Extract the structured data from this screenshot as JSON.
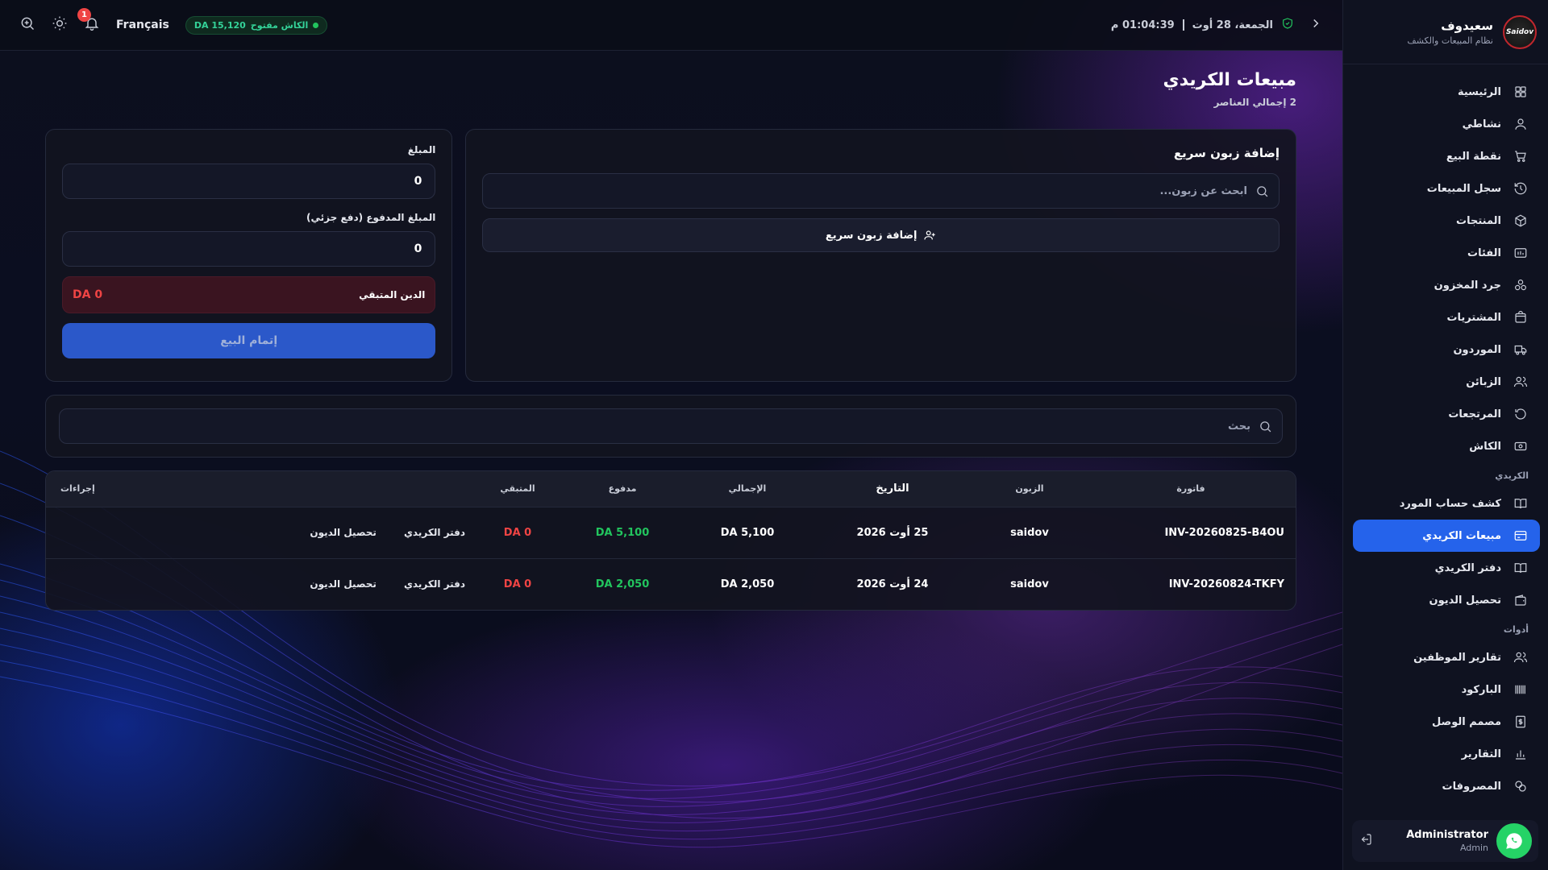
{
  "brand": {
    "name": "سعيدوف",
    "subtitle": "نظام المبيعات والكشف",
    "logo_text": "Saidov"
  },
  "topbar": {
    "datetime_date": "الجمعة، 28 أوت",
    "datetime_time": "01:04:39 م",
    "cash_status": "الكاش مفتوح",
    "cash_amount": "DA 15,120",
    "language": "Français",
    "notification_count": "1"
  },
  "sidebar": {
    "items": [
      {
        "label": "الرئيسية",
        "icon": "grid-icon"
      },
      {
        "label": "نشاطي",
        "icon": "user-icon"
      },
      {
        "label": "نقطة البيع",
        "icon": "cart-icon"
      },
      {
        "label": "سجل المبيعات",
        "icon": "history-icon"
      },
      {
        "label": "المنتجات",
        "icon": "box-icon"
      },
      {
        "label": "الفئات",
        "icon": "category-icon"
      },
      {
        "label": "جرد المخزون",
        "icon": "stock-icon"
      },
      {
        "label": "المشتريات",
        "icon": "bag-icon"
      },
      {
        "label": "الموردون",
        "icon": "truck-icon"
      },
      {
        "label": "الزبائن",
        "icon": "users-icon"
      },
      {
        "label": "المرتجعات",
        "icon": "return-icon"
      },
      {
        "label": "الكاش",
        "icon": "cash-icon"
      }
    ],
    "section_credit": "الكريدي",
    "credit_items": [
      {
        "label": "كشف حساب المورد",
        "icon": "book-icon"
      },
      {
        "label": "مبيعات الكريدي",
        "icon": "card-icon",
        "active": true
      },
      {
        "label": "دفتر الكريدي",
        "icon": "book-icon"
      },
      {
        "label": "تحصيل الديون",
        "icon": "wallet-icon"
      }
    ],
    "section_tools": "أدوات",
    "tool_items": [
      {
        "label": "تقارير الموظفين",
        "icon": "users-icon"
      },
      {
        "label": "الباركود",
        "icon": "barcode-icon"
      },
      {
        "label": "مصمم الوصل",
        "icon": "receipt-icon"
      },
      {
        "label": "التقارير",
        "icon": "chart-icon"
      },
      {
        "label": "المصروفات",
        "icon": "coins-icon"
      }
    ],
    "user": {
      "name": "Administrator",
      "role": "Admin"
    }
  },
  "page": {
    "title": "مبيعات الكريدي",
    "subtitle": "2 إجمالي العناصر"
  },
  "customer": {
    "title": "إضافة زبون سريع",
    "search_placeholder": "ابحث عن زبون...",
    "quick_add_label": "إضافة زبون سريع"
  },
  "amount": {
    "amount_label": "المبلغ",
    "amount_value": "0",
    "paid_label": "المبلغ المدفوع (دفع جزئي)",
    "paid_value": "0",
    "debt_label": "الدين المتبقي",
    "debt_value": "DA 0",
    "complete_label": "إتمام البيع"
  },
  "list_search": {
    "placeholder": "بحث"
  },
  "table": {
    "headers": {
      "invoice": "فاتورة",
      "customer": "الزبون",
      "date": "التاريخ",
      "total": "الإجمالي",
      "paid": "مدفوع",
      "remaining": "المتبقي",
      "actions": "إجراءات"
    },
    "rows": [
      {
        "invoice": "INV-20260825-B4OU",
        "customer": "saidov",
        "date": "25 أوت 2026",
        "total": "DA 5,100",
        "paid": "DA 5,100",
        "remaining": "DA 0",
        "action1": "دفتر الكريدي",
        "action2": "تحصيل الديون"
      },
      {
        "invoice": "INV-20260824-TKFY",
        "customer": "saidov",
        "date": "24 أوت 2026",
        "total": "DA 2,050",
        "paid": "DA 2,050",
        "remaining": "DA 0",
        "action1": "دفتر الكريدي",
        "action2": "تحصيل الديون"
      }
    ]
  },
  "colors": {
    "accent": "#2563eb",
    "success": "#22c55e",
    "danger": "#ef4444",
    "background": "#0b0d16"
  }
}
